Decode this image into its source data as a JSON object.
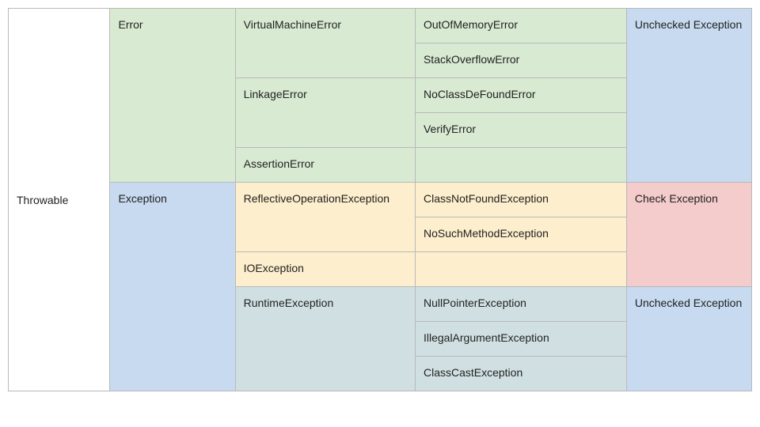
{
  "root": "Throwable",
  "rows": [
    {
      "l1": "Error",
      "l2": "VirtualMachineError",
      "l3": "OutOfMemoryError",
      "note": "Unchecked Exception"
    },
    {
      "l1": "",
      "l2": "",
      "l3": "StackOverflowError",
      "note": ""
    },
    {
      "l1": "",
      "l2": "LinkageError",
      "l3": "NoClassDeFoundError",
      "note": ""
    },
    {
      "l1": "",
      "l2": "",
      "l3": "VerifyError",
      "note": ""
    },
    {
      "l1": "",
      "l2": "AssertionError",
      "l3": "",
      "note": ""
    },
    {
      "l1": "Exception",
      "l2": "ReflectiveOperationException",
      "l3": "ClassNotFoundException",
      "note": "Check Exception"
    },
    {
      "l1": "",
      "l2": "",
      "l3": "NoSuchMethodException",
      "note": ""
    },
    {
      "l1": "",
      "l2": "IOException",
      "l3": "",
      "note": ""
    },
    {
      "l1": "",
      "l2": "RuntimeException",
      "l3": "NullPointerException",
      "note": "Unchecked Exception"
    },
    {
      "l1": "",
      "l2": "",
      "l3": "IllegalArgumentException",
      "note": ""
    },
    {
      "l1": "",
      "l2": "",
      "l3": "ClassCastException",
      "note": ""
    }
  ]
}
